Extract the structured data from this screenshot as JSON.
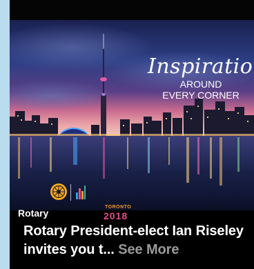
{
  "post": {
    "image_caption": {
      "script_line": "Inspiration",
      "line2": "AROUND",
      "line3": "EVERY CORNER"
    },
    "logo": {
      "rotary_text": "Rotary",
      "event_city": "TORONTO",
      "event_year": "2018"
    },
    "headline": "Rotary President-elect Ian Riseley invites you t...",
    "see_more_label": "See More"
  },
  "colors": {
    "page_background": "#b9dcef",
    "card_background": "#000000",
    "headline_text": "#ffffff",
    "see_more_text": "#9a9a9a",
    "rotary_gold": "#f7a81b"
  },
  "icons": [
    "rotary-wheel-icon",
    "toronto-2018-skyline-icon"
  ]
}
